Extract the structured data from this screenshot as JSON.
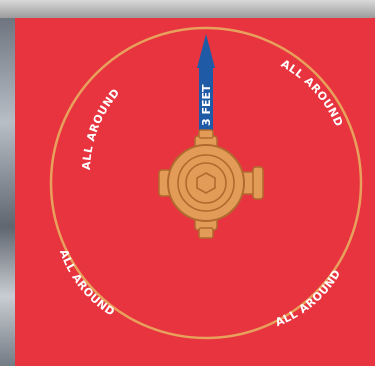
{
  "diagram": {
    "distance_label": "3 FEET",
    "ring_labels": [
      "ALL AROUND",
      "ALL AROUND",
      "ALL AROUND",
      "ALL AROUND"
    ],
    "colors": {
      "background": "#e8343f",
      "ring": "#e8a15c",
      "arrow": "#1f5aa6",
      "valve": "#e39c58",
      "valve_outline": "#b06a2e",
      "text": "#ffffff"
    }
  }
}
